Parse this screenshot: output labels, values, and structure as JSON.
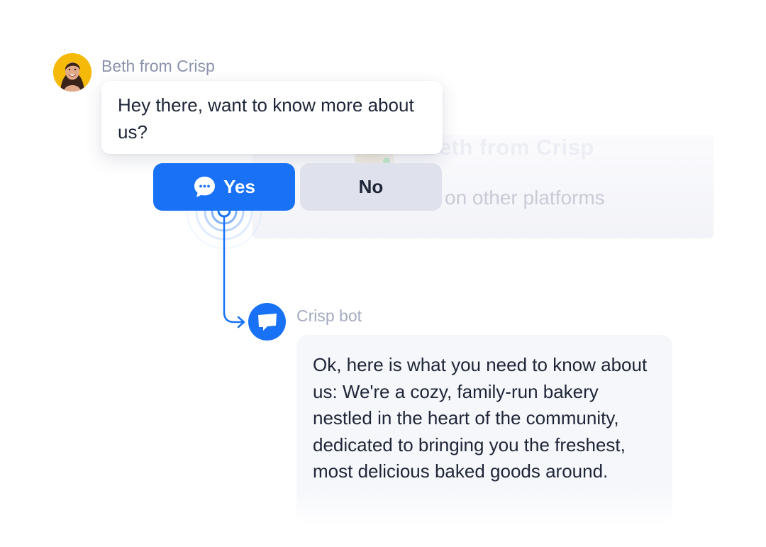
{
  "background_card": {
    "title": "Beth from Crisp",
    "subtitle": "on other platforms"
  },
  "beth": {
    "name": "Beth from Crisp",
    "message": "Hey there, want to know more about us?"
  },
  "buttons": {
    "yes_label": "Yes",
    "no_label": "No"
  },
  "bot": {
    "name": "Crisp bot",
    "message": "Ok, here is what you need to know about us: We're a cozy, family-run bakery nestled in the heart of the community, dedicated to bringing you the freshest, most delicious baked goods around."
  },
  "icons": {
    "yes_button": "chat-bubble-dots-icon",
    "bot_avatar": "crisp-chat-icon",
    "beth_avatar": "avatar",
    "connector": "arrow-connector-icon"
  },
  "colors": {
    "accent": "#1972f5",
    "avatar_bg": "#f5b90a",
    "secondary_button": "#dfe2ec",
    "text": "#1e2536",
    "muted": "#8b93ac"
  }
}
